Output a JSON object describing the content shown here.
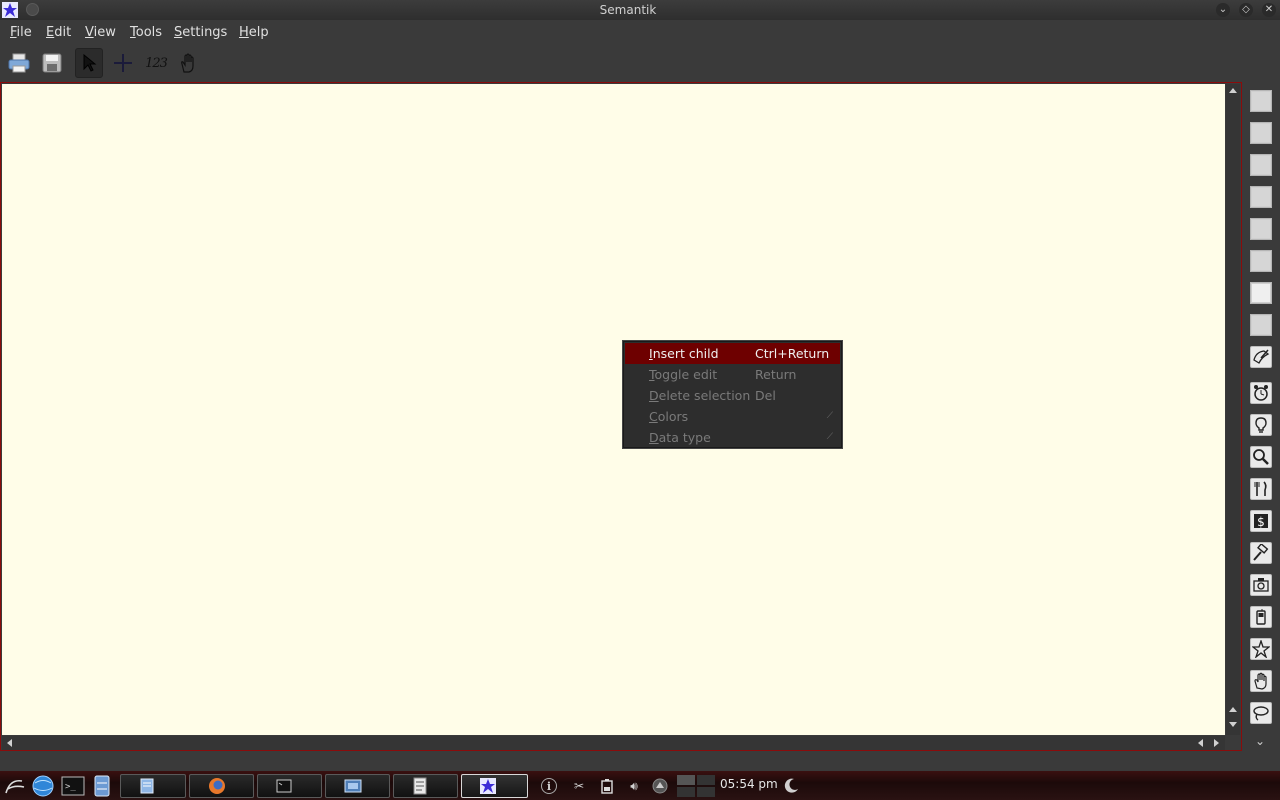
{
  "window": {
    "title": "Semantik",
    "controls": {
      "minimize": "⌄",
      "maximize": "◇",
      "close": "✕"
    }
  },
  "menubar": {
    "items": [
      {
        "label": "File",
        "accel": "F",
        "rest": "ile"
      },
      {
        "label": "Edit",
        "accel": "E",
        "rest": "dit"
      },
      {
        "label": "View",
        "accel": "V",
        "rest": "iew"
      },
      {
        "label": "Tools",
        "accel": "T",
        "rest": "ools"
      },
      {
        "label": "Settings",
        "accel": "S",
        "rest": "ettings"
      },
      {
        "label": "Help",
        "accel": "H",
        "rest": "elp"
      }
    ]
  },
  "toolbar": {
    "items": [
      {
        "icon": "print-icon"
      },
      {
        "icon": "save-icon"
      },
      {
        "icon": "select-pointer-icon",
        "active": true
      },
      {
        "icon": "crosshair-icon"
      },
      {
        "icon": "sort-numbers-icon",
        "text": "123"
      },
      {
        "icon": "pan-hand-icon"
      }
    ]
  },
  "colors": {
    "canvas": "#fffde8",
    "accent": "#8b0b0b",
    "menu_highlight": "#6e0000",
    "chrome": "#3a3a3a"
  },
  "context_menu": {
    "items": [
      {
        "accel": "I",
        "rest": "nsert child",
        "shortcut": "Ctrl+Return",
        "enabled": true,
        "highlighted": true
      },
      {
        "accel": "T",
        "rest": "oggle edit",
        "shortcut": "Return",
        "enabled": false
      },
      {
        "accel": "D",
        "rest": "elete selection",
        "shortcut": "Del",
        "enabled": false
      },
      {
        "accel": "C",
        "rest": "olors",
        "shortcut": "",
        "enabled": false,
        "submenu": true
      },
      {
        "accel": "D",
        "rest": "ata type",
        "shortcut": "",
        "enabled": false,
        "submenu": true
      }
    ]
  },
  "palette": {
    "swatches": 8,
    "icons": [
      "painting-icon",
      "alarm-clock-icon",
      "lightbulb-icon",
      "magnifier-icon",
      "fork-knife-icon",
      "dollar-icon",
      "hammer-icon",
      "camera-icon",
      "mobile-phone-icon",
      "star-icon",
      "hand-icon",
      "lasso-icon"
    ],
    "more": "⌄"
  },
  "taskbar": {
    "clock": "05:54 pm",
    "tray_info": "i",
    "tray_icons": [
      "info-icon",
      "scissors-icon",
      "battery-icon",
      "volume-icon",
      "eject-icon"
    ]
  }
}
